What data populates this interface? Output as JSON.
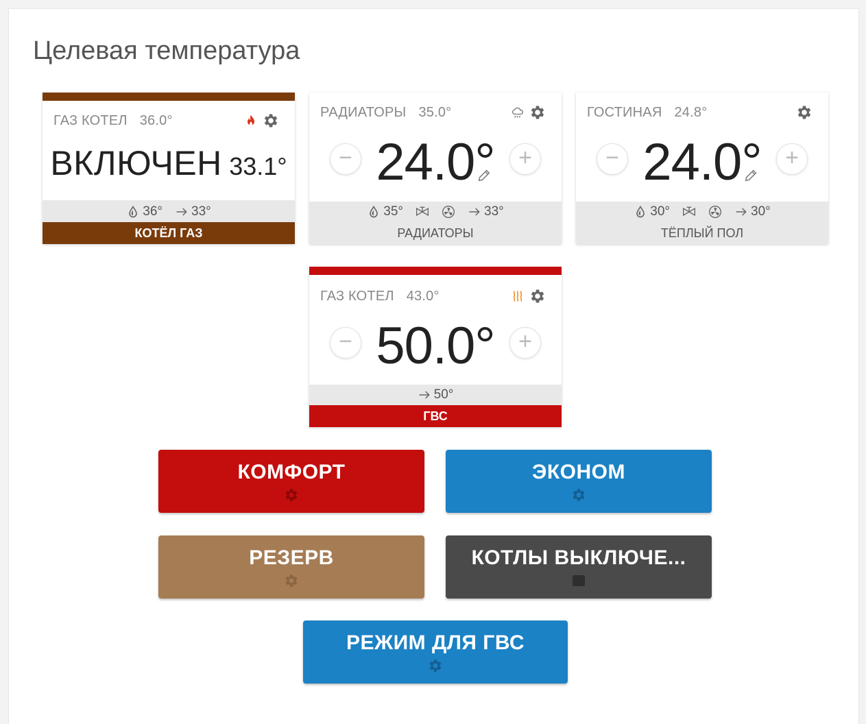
{
  "title": "Целевая температура",
  "colors": {
    "boiler_brown": "#7a3b0b",
    "red": "#c40d0d",
    "blue": "#1b82c5",
    "tan": "#a67c55",
    "dark_gray": "#4a4a4a"
  },
  "cards": {
    "gas_boiler": {
      "name": "ГАЗ КОТЕЛ",
      "temp": "36.0°",
      "status": "ВКЛЮЧЕН",
      "status_temp": "33.1°",
      "drop": "36°",
      "arrow": "33°",
      "footer": "КОТЁЛ ГАЗ",
      "icons": [
        "flame-icon",
        "gear-icon"
      ]
    },
    "radiators": {
      "name": "РАДИАТОРЫ",
      "temp": "35.0°",
      "target": "24.0°",
      "drop": "35°",
      "arrow": "33°",
      "footer": "РАДИАТОРЫ",
      "icons": [
        "weather-icon",
        "gear-icon"
      ]
    },
    "living_room": {
      "name": "ГОСТИНАЯ",
      "temp": "24.8°",
      "target": "24.0°",
      "drop": "30°",
      "arrow": "30°",
      "footer": "ТЁПЛЫЙ ПОЛ",
      "icons": [
        "gear-icon"
      ]
    },
    "hot_water": {
      "name": "ГАЗ КОТЕЛ",
      "temp": "43.0°",
      "target": "50.0°",
      "arrow": "50°",
      "footer": "ГВС",
      "icons": [
        "heat-waves-icon",
        "gear-icon"
      ]
    }
  },
  "controls": {
    "minus": "−",
    "plus": "+"
  },
  "modes": {
    "comfort": "КОМФОРТ",
    "economy": "ЭКОНОМ",
    "reserve": "РЕЗЕРВ",
    "boilers_off": "КОТЛЫ ВЫКЛЮЧЕ...",
    "hot_water_mode": "РЕЖИМ ДЛЯ ГВС"
  }
}
